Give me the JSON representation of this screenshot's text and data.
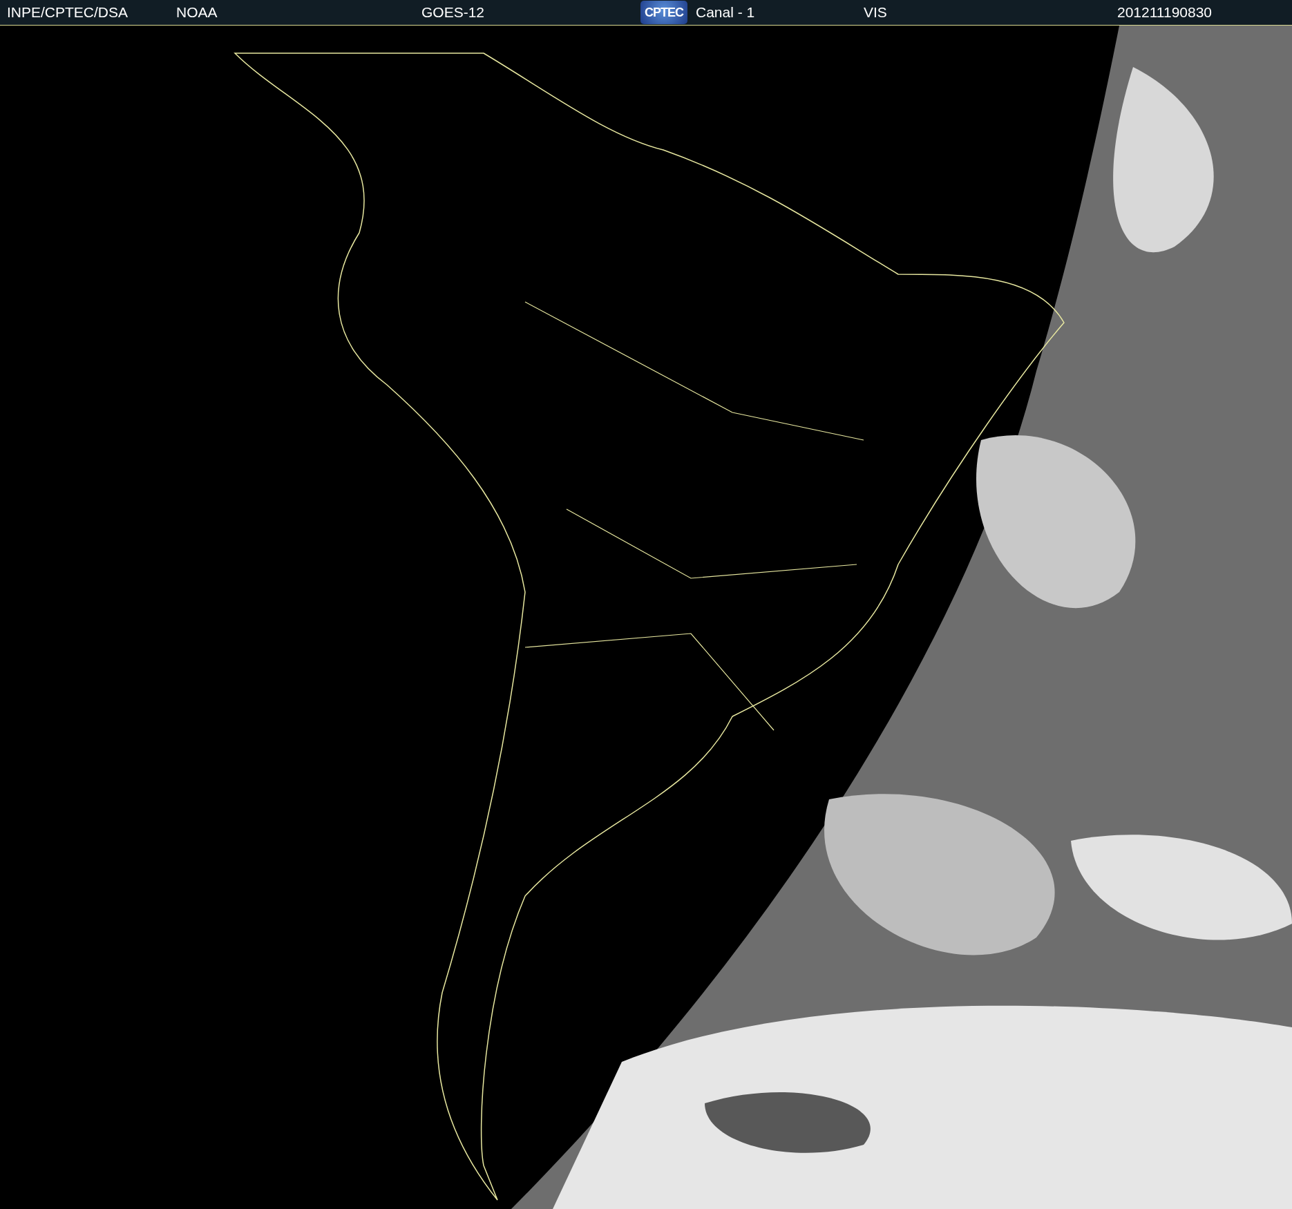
{
  "header": {
    "items": [
      {
        "kind": "text",
        "text": "INPE/CPTEC/DSA"
      },
      {
        "kind": "text",
        "text": "NOAA"
      },
      {
        "kind": "text",
        "text": "GOES-12"
      },
      {
        "kind": "logo",
        "text": "CPTEC"
      },
      {
        "kind": "text",
        "text": "Canal - 1"
      },
      {
        "kind": "text",
        "text": "VIS"
      },
      {
        "kind": "text",
        "text": "201211190830"
      }
    ]
  }
}
